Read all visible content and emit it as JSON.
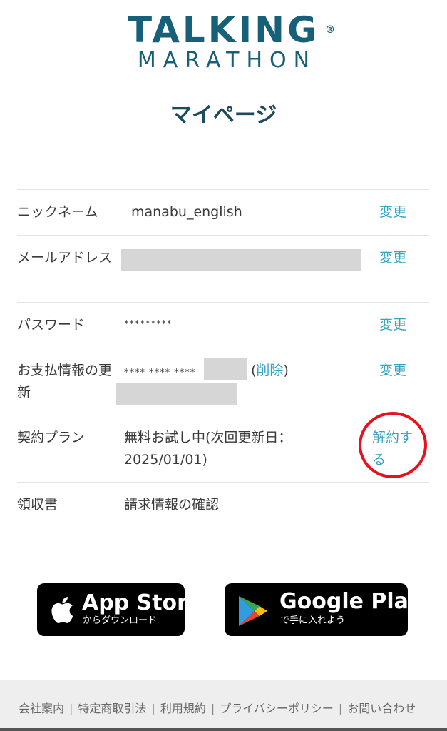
{
  "logo": {
    "line1": "TALKING",
    "registered": "®",
    "line2": "MARATHON"
  },
  "page_title": "マイページ",
  "rows": [
    {
      "label": "ニックネーム",
      "value": "manabu_english",
      "action": "変更"
    },
    {
      "label": "メールアドレス",
      "action": "変更"
    },
    {
      "label": "パスワード",
      "value": "*********",
      "action": "変更"
    },
    {
      "label": "お支払情報の更新",
      "value": "**** **** ****",
      "delete_label": "削除",
      "action": "変更"
    },
    {
      "label": "契約プラン",
      "value": "無料お試し中(次回更新日：2025/01/01)",
      "action": "解約する"
    },
    {
      "label": "領収書",
      "link": "請求情報の確認"
    }
  ],
  "stores": {
    "app_store": {
      "title": "App Store",
      "subtitle": "からダウンロード"
    },
    "google_play": {
      "title": "Google Play",
      "subtitle": "で手に入れよう"
    }
  },
  "footer": {
    "links": [
      "会社案内",
      "特定商取引法",
      "利用規約",
      "プライバシーポリシー",
      "お問い合わせ"
    ]
  },
  "colors": {
    "brand": "#17607a",
    "link": "#3aa3bf",
    "highlight_circle": "#e8121c"
  },
  "icons": [
    "apple-logo-icon",
    "google-play-icon"
  ]
}
